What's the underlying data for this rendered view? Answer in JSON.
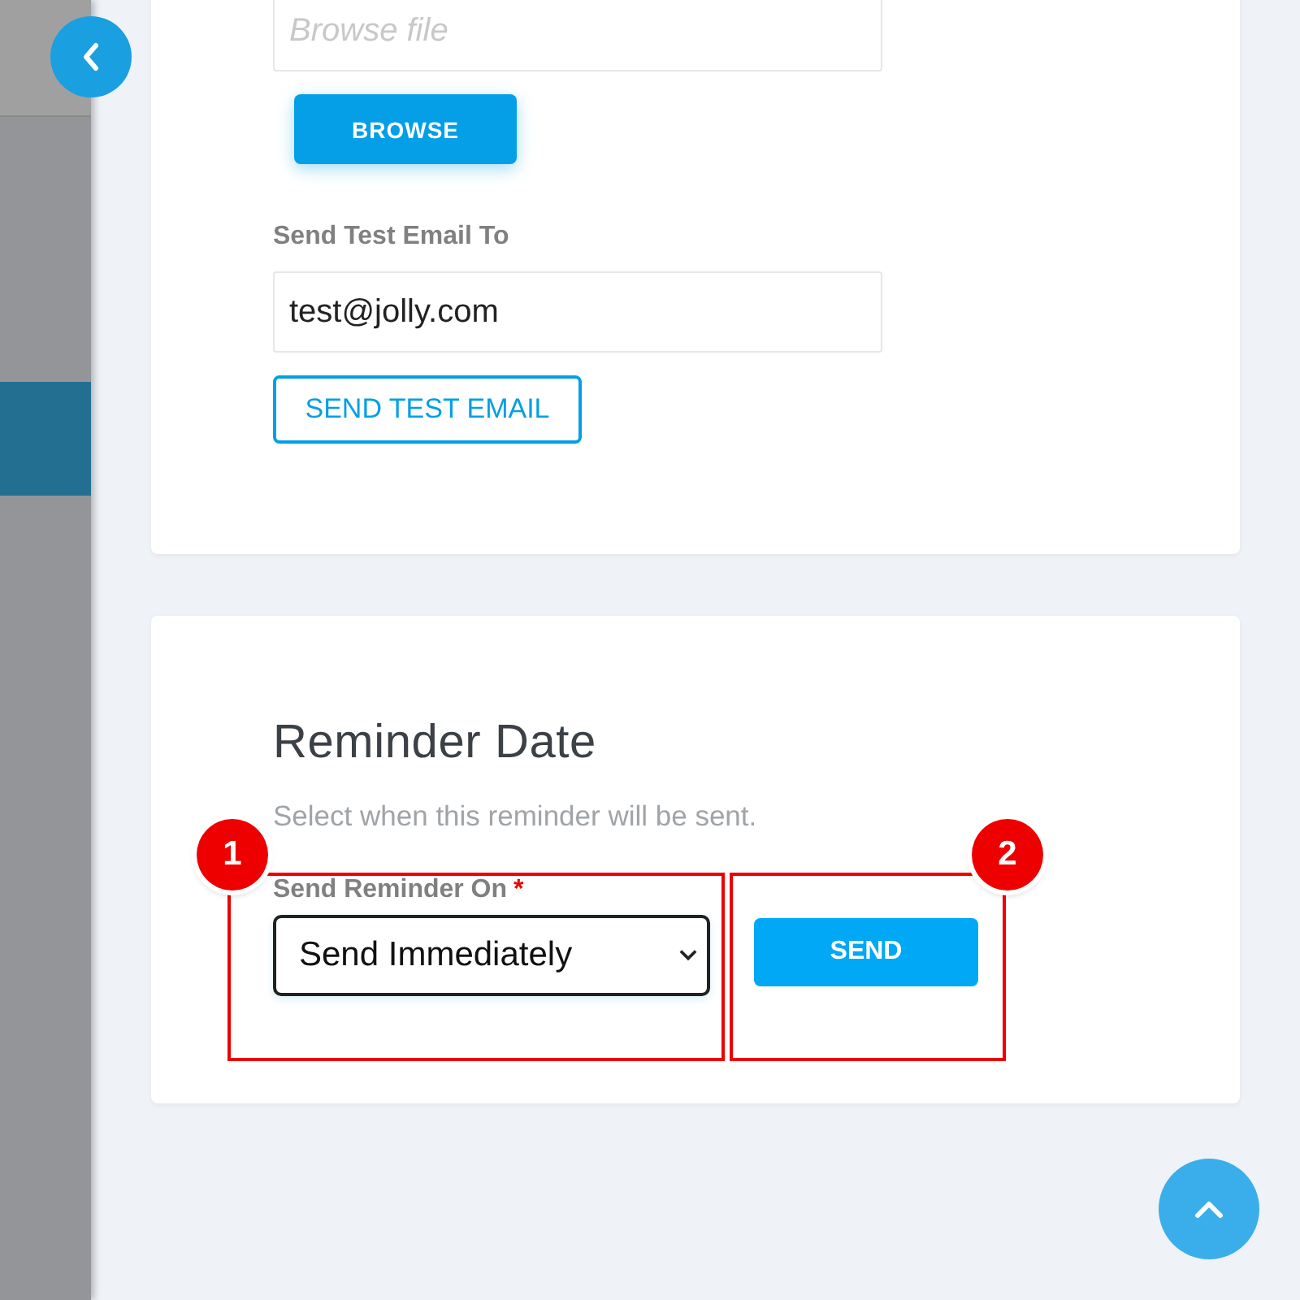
{
  "upload": {
    "file_field": {
      "placeholder": "Browse file"
    },
    "browse_button": "BROWSE",
    "test_email_label": "Send Test Email To",
    "test_email_field": {
      "value": "test@jolly.com"
    },
    "send_test_button": "SEND TEST EMAIL"
  },
  "reminder": {
    "title": "Reminder Date",
    "subtitle": "Select when this reminder will be sent.",
    "field_label": "Send Reminder On",
    "required_mark": "*",
    "select": {
      "value": "Send Immediately"
    },
    "send_button": "SEND"
  },
  "annotations": [
    {
      "number": "1"
    },
    {
      "number": "2"
    }
  ]
}
